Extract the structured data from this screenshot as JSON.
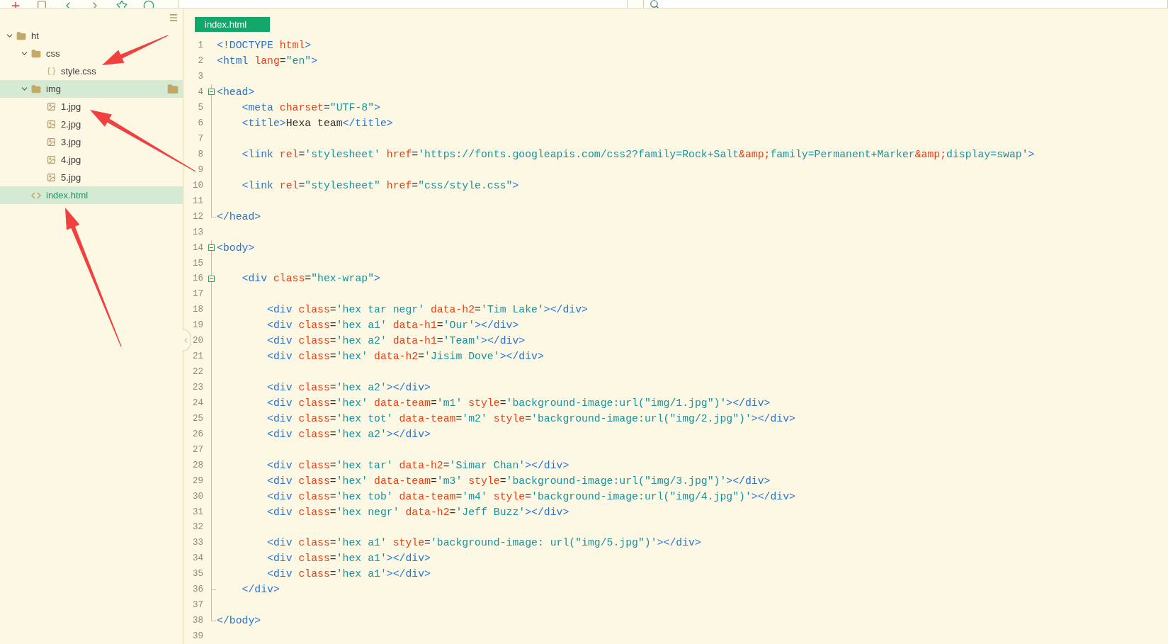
{
  "sidebar": {
    "tree": [
      {
        "label": "ht",
        "kind": "project",
        "expanded": true,
        "selected": false,
        "open": false,
        "children": [
          {
            "label": "css",
            "kind": "folder",
            "expanded": true,
            "selected": false,
            "open": false,
            "children": [
              {
                "label": "style.css",
                "kind": "css",
                "selected": false,
                "open": false
              }
            ]
          },
          {
            "label": "img",
            "kind": "folder",
            "expanded": true,
            "selected": true,
            "open": false,
            "children": [
              {
                "label": "1.jpg",
                "kind": "image",
                "selected": false,
                "open": false
              },
              {
                "label": "2.jpg",
                "kind": "image",
                "selected": false,
                "open": false
              },
              {
                "label": "3.jpg",
                "kind": "image",
                "selected": false,
                "open": false
              },
              {
                "label": "4.jpg",
                "kind": "image",
                "selected": false,
                "open": false
              },
              {
                "label": "5.jpg",
                "kind": "image",
                "selected": false,
                "open": false
              }
            ]
          },
          {
            "label": "index.html",
            "kind": "html",
            "selected": true,
            "open": true
          }
        ]
      }
    ]
  },
  "editor": {
    "tabs": [
      {
        "label": "index.html",
        "selected": true
      }
    ],
    "lines": [
      {
        "n": "1",
        "tokens": [
          {
            "kind": "tag",
            "text": "<!DOCTYPE "
          },
          {
            "kind": "attr",
            "text": "html"
          },
          {
            "kind": "tag",
            "text": ">"
          }
        ]
      },
      {
        "n": "2",
        "tokens": [
          {
            "kind": "tag",
            "text": "<html "
          },
          {
            "kind": "attr",
            "text": "lang"
          },
          {
            "kind": "plain",
            "text": "="
          },
          {
            "kind": "str",
            "text": "\"en\""
          },
          {
            "kind": "tag",
            "text": ">"
          }
        ]
      },
      {
        "n": "3"
      },
      {
        "n": "4",
        "kind": "start",
        "tokens": [
          {
            "kind": "tag",
            "text": "<head>"
          }
        ]
      },
      {
        "n": "5",
        "kind": "inside",
        "tokens": [
          {
            "kind": "tag",
            "text": "    <meta "
          },
          {
            "kind": "attr",
            "text": "charset"
          },
          {
            "kind": "plain",
            "text": "="
          },
          {
            "kind": "str",
            "text": "\"UTF-8\""
          },
          {
            "kind": "tag",
            "text": ">"
          }
        ]
      },
      {
        "n": "6",
        "kind": "inside",
        "tokens": [
          {
            "kind": "tag",
            "text": "    <title>"
          },
          {
            "kind": "plain",
            "text": "Hexa team"
          },
          {
            "kind": "tag",
            "text": "</title>"
          }
        ]
      },
      {
        "n": "7",
        "kind": "inside"
      },
      {
        "n": "8",
        "kind": "inside",
        "tokens": [
          {
            "kind": "tag",
            "text": "    <link "
          },
          {
            "kind": "attr",
            "text": "rel"
          },
          {
            "kind": "plain",
            "text": "="
          },
          {
            "kind": "str",
            "text": "'stylesheet'"
          },
          {
            "kind": "attr",
            "text": " href"
          },
          {
            "kind": "plain",
            "text": "="
          },
          {
            "kind": "str",
            "text": "'https://fonts.googleapis.com/css2?family=Rock+Salt"
          },
          {
            "kind": "attr",
            "text": "&amp;"
          },
          {
            "kind": "str",
            "text": "family=Permanent+Marker"
          },
          {
            "kind": "attr",
            "text": "&amp;"
          },
          {
            "kind": "str",
            "text": "display=swap'"
          },
          {
            "kind": "tag",
            "text": ">"
          }
        ]
      },
      {
        "n": "9",
        "kind": "inside"
      },
      {
        "n": "10",
        "kind": "inside",
        "tokens": [
          {
            "kind": "tag",
            "text": "    <link "
          },
          {
            "kind": "attr",
            "text": "rel"
          },
          {
            "kind": "plain",
            "text": "="
          },
          {
            "kind": "str",
            "text": "\"stylesheet\""
          },
          {
            "kind": "attr",
            "text": " href"
          },
          {
            "kind": "plain",
            "text": "="
          },
          {
            "kind": "str",
            "text": "\"css/style.css\""
          },
          {
            "kind": "tag",
            "text": ">"
          }
        ]
      },
      {
        "n": "11",
        "kind": "inside"
      },
      {
        "n": "12",
        "kind": "end",
        "tokens": [
          {
            "kind": "tag",
            "text": "</head>"
          }
        ]
      },
      {
        "n": "13"
      },
      {
        "n": "14",
        "kind": "start",
        "tokens": [
          {
            "kind": "tag",
            "text": "<body>"
          }
        ]
      },
      {
        "n": "15",
        "kind": "inside"
      },
      {
        "n": "16",
        "kind": "start",
        "tokens": [
          {
            "kind": "tag",
            "text": "    <div "
          },
          {
            "kind": "attr",
            "text": "class"
          },
          {
            "kind": "plain",
            "text": "="
          },
          {
            "kind": "str",
            "text": "\"hex-wrap\""
          },
          {
            "kind": "tag",
            "text": ">"
          }
        ]
      },
      {
        "n": "17",
        "kind": "inside"
      },
      {
        "n": "18",
        "kind": "inside",
        "tokens": [
          {
            "kind": "tag",
            "text": "        <div "
          },
          {
            "kind": "attr",
            "text": "class"
          },
          {
            "kind": "plain",
            "text": "="
          },
          {
            "kind": "str",
            "text": "'hex tar negr'"
          },
          {
            "kind": "attr",
            "text": " data-h2"
          },
          {
            "kind": "plain",
            "text": "="
          },
          {
            "kind": "str",
            "text": "'Tim Lake'"
          },
          {
            "kind": "tag",
            "text": "></div>"
          }
        ]
      },
      {
        "n": "19",
        "kind": "inside",
        "tokens": [
          {
            "kind": "tag",
            "text": "        <div "
          },
          {
            "kind": "attr",
            "text": "class"
          },
          {
            "kind": "plain",
            "text": "="
          },
          {
            "kind": "str",
            "text": "'hex a1'"
          },
          {
            "kind": "attr",
            "text": " data-h1"
          },
          {
            "kind": "plain",
            "text": "="
          },
          {
            "kind": "str",
            "text": "'Our'"
          },
          {
            "kind": "tag",
            "text": "></div>"
          }
        ]
      },
      {
        "n": "20",
        "kind": "inside",
        "tokens": [
          {
            "kind": "tag",
            "text": "        <div "
          },
          {
            "kind": "attr",
            "text": "class"
          },
          {
            "kind": "plain",
            "text": "="
          },
          {
            "kind": "str",
            "text": "'hex a2'"
          },
          {
            "kind": "attr",
            "text": " data-h1"
          },
          {
            "kind": "plain",
            "text": "="
          },
          {
            "kind": "str",
            "text": "'Team'"
          },
          {
            "kind": "tag",
            "text": "></div>"
          }
        ]
      },
      {
        "n": "21",
        "kind": "inside",
        "tokens": [
          {
            "kind": "tag",
            "text": "        <div "
          },
          {
            "kind": "attr",
            "text": "class"
          },
          {
            "kind": "plain",
            "text": "="
          },
          {
            "kind": "str",
            "text": "'hex'"
          },
          {
            "kind": "attr",
            "text": " data-h2"
          },
          {
            "kind": "plain",
            "text": "="
          },
          {
            "kind": "str",
            "text": "'Jisim Dove'"
          },
          {
            "kind": "tag",
            "text": "></div>"
          }
        ]
      },
      {
        "n": "22",
        "kind": "inside"
      },
      {
        "n": "23",
        "kind": "inside",
        "tokens": [
          {
            "kind": "tag",
            "text": "        <div "
          },
          {
            "kind": "attr",
            "text": "class"
          },
          {
            "kind": "plain",
            "text": "="
          },
          {
            "kind": "str",
            "text": "'hex a2'"
          },
          {
            "kind": "tag",
            "text": "></div>"
          }
        ]
      },
      {
        "n": "24",
        "kind": "inside",
        "tokens": [
          {
            "kind": "tag",
            "text": "        <div "
          },
          {
            "kind": "attr",
            "text": "class"
          },
          {
            "kind": "plain",
            "text": "="
          },
          {
            "kind": "str",
            "text": "'hex'"
          },
          {
            "kind": "attr",
            "text": " data-team"
          },
          {
            "kind": "plain",
            "text": "="
          },
          {
            "kind": "str",
            "text": "'m1'"
          },
          {
            "kind": "attr",
            "text": " style"
          },
          {
            "kind": "plain",
            "text": "="
          },
          {
            "kind": "str",
            "text": "'background-image:url(\"img/1.jpg\")'"
          },
          {
            "kind": "tag",
            "text": "></div>"
          }
        ]
      },
      {
        "n": "25",
        "kind": "inside",
        "tokens": [
          {
            "kind": "tag",
            "text": "        <div "
          },
          {
            "kind": "attr",
            "text": "class"
          },
          {
            "kind": "plain",
            "text": "="
          },
          {
            "kind": "str",
            "text": "'hex tot'"
          },
          {
            "kind": "attr",
            "text": " data-team"
          },
          {
            "kind": "plain",
            "text": "="
          },
          {
            "kind": "str",
            "text": "'m2'"
          },
          {
            "kind": "attr",
            "text": " style"
          },
          {
            "kind": "plain",
            "text": "="
          },
          {
            "kind": "str",
            "text": "'background-image:url(\"img/2.jpg\")'"
          },
          {
            "kind": "tag",
            "text": "></div>"
          }
        ]
      },
      {
        "n": "26",
        "kind": "inside",
        "tokens": [
          {
            "kind": "tag",
            "text": "        <div "
          },
          {
            "kind": "attr",
            "text": "class"
          },
          {
            "kind": "plain",
            "text": "="
          },
          {
            "kind": "str",
            "text": "'hex a2'"
          },
          {
            "kind": "tag",
            "text": "></div>"
          }
        ]
      },
      {
        "n": "27",
        "kind": "inside"
      },
      {
        "n": "28",
        "kind": "inside",
        "tokens": [
          {
            "kind": "tag",
            "text": "        <div "
          },
          {
            "kind": "attr",
            "text": "class"
          },
          {
            "kind": "plain",
            "text": "="
          },
          {
            "kind": "str",
            "text": "'hex tar'"
          },
          {
            "kind": "attr",
            "text": " data-h2"
          },
          {
            "kind": "plain",
            "text": "="
          },
          {
            "kind": "str",
            "text": "'Simar Chan'"
          },
          {
            "kind": "tag",
            "text": "></div>"
          }
        ]
      },
      {
        "n": "29",
        "kind": "inside",
        "tokens": [
          {
            "kind": "tag",
            "text": "        <div "
          },
          {
            "kind": "attr",
            "text": "class"
          },
          {
            "kind": "plain",
            "text": "="
          },
          {
            "kind": "str",
            "text": "'hex'"
          },
          {
            "kind": "attr",
            "text": " data-team"
          },
          {
            "kind": "plain",
            "text": "="
          },
          {
            "kind": "str",
            "text": "'m3'"
          },
          {
            "kind": "attr",
            "text": " style"
          },
          {
            "kind": "plain",
            "text": "="
          },
          {
            "kind": "str",
            "text": "'background-image:url(\"img/3.jpg\")'"
          },
          {
            "kind": "tag",
            "text": "></div>"
          }
        ]
      },
      {
        "n": "30",
        "kind": "inside",
        "tokens": [
          {
            "kind": "tag",
            "text": "        <div "
          },
          {
            "kind": "attr",
            "text": "class"
          },
          {
            "kind": "plain",
            "text": "="
          },
          {
            "kind": "str",
            "text": "'hex tob'"
          },
          {
            "kind": "attr",
            "text": " data-team"
          },
          {
            "kind": "plain",
            "text": "="
          },
          {
            "kind": "str",
            "text": "'m4'"
          },
          {
            "kind": "attr",
            "text": " style"
          },
          {
            "kind": "plain",
            "text": "="
          },
          {
            "kind": "str",
            "text": "'background-image:url(\"img/4.jpg\")'"
          },
          {
            "kind": "tag",
            "text": "></div>"
          }
        ]
      },
      {
        "n": "31",
        "kind": "inside",
        "tokens": [
          {
            "kind": "tag",
            "text": "        <div "
          },
          {
            "kind": "attr",
            "text": "class"
          },
          {
            "kind": "plain",
            "text": "="
          },
          {
            "kind": "str",
            "text": "'hex negr'"
          },
          {
            "kind": "attr",
            "text": " data-h2"
          },
          {
            "kind": "plain",
            "text": "="
          },
          {
            "kind": "str",
            "text": "'Jeff Buzz'"
          },
          {
            "kind": "tag",
            "text": "></div>"
          }
        ]
      },
      {
        "n": "32",
        "kind": "inside"
      },
      {
        "n": "33",
        "kind": "inside",
        "tokens": [
          {
            "kind": "tag",
            "text": "        <div "
          },
          {
            "kind": "attr",
            "text": "class"
          },
          {
            "kind": "plain",
            "text": "="
          },
          {
            "kind": "str",
            "text": "'hex a1'"
          },
          {
            "kind": "attr",
            "text": " style"
          },
          {
            "kind": "plain",
            "text": "="
          },
          {
            "kind": "str",
            "text": "'background-image: url(\"img/5.jpg\")'"
          },
          {
            "kind": "tag",
            "text": "></div>"
          }
        ]
      },
      {
        "n": "34",
        "kind": "inside",
        "tokens": [
          {
            "kind": "tag",
            "text": "        <div "
          },
          {
            "kind": "attr",
            "text": "class"
          },
          {
            "kind": "plain",
            "text": "="
          },
          {
            "kind": "str",
            "text": "'hex a1'"
          },
          {
            "kind": "tag",
            "text": "></div>"
          }
        ]
      },
      {
        "n": "35",
        "kind": "inside",
        "tokens": [
          {
            "kind": "tag",
            "text": "        <div "
          },
          {
            "kind": "attr",
            "text": "class"
          },
          {
            "kind": "plain",
            "text": "="
          },
          {
            "kind": "str",
            "text": "'hex a1'"
          },
          {
            "kind": "tag",
            "text": "></div>"
          }
        ]
      },
      {
        "n": "36",
        "kind": "inner_end",
        "tokens": [
          {
            "kind": "tag",
            "text": "    </div>"
          }
        ]
      },
      {
        "n": "37",
        "kind": "inside"
      },
      {
        "n": "38",
        "kind": "end",
        "tokens": [
          {
            "kind": "tag",
            "text": "</body>"
          }
        ]
      },
      {
        "n": "39"
      }
    ]
  }
}
